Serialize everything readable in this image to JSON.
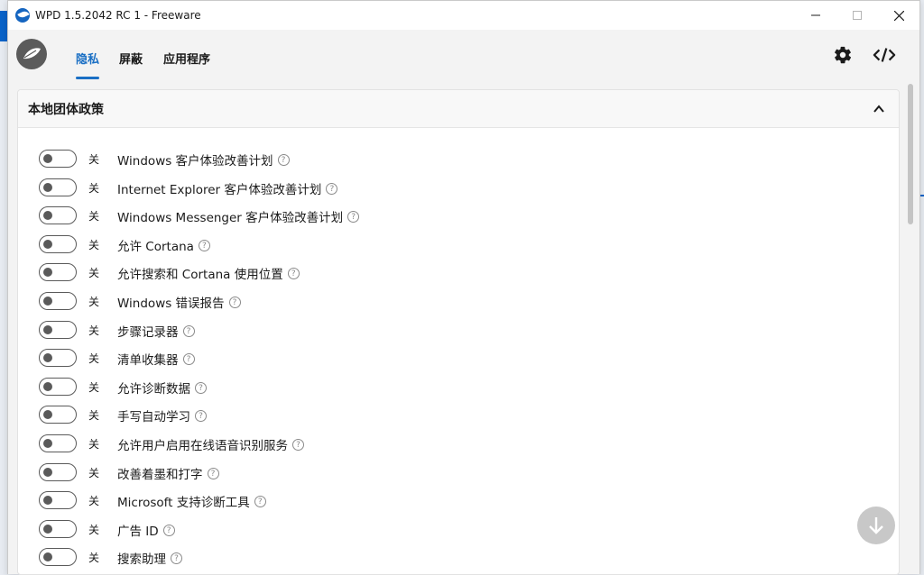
{
  "window": {
    "title": "WPD 1.5.2042 RC 1 - Freeware"
  },
  "tabs": [
    {
      "label": "隐私",
      "active": true
    },
    {
      "label": "屏蔽",
      "active": false
    },
    {
      "label": "应用程序",
      "active": false
    }
  ],
  "toolbar_icons": [
    "gear-icon",
    "code-icon"
  ],
  "panel": {
    "title": "本地团体政策"
  },
  "items": [
    {
      "state": "关",
      "label": "Windows 客户体验改善计划"
    },
    {
      "state": "关",
      "label": "Internet Explorer 客户体验改善计划"
    },
    {
      "state": "关",
      "label": "Windows Messenger 客户体验改善计划"
    },
    {
      "state": "关",
      "label": "允许 Cortana"
    },
    {
      "state": "关",
      "label": "允许搜索和 Cortana 使用位置"
    },
    {
      "state": "关",
      "label": "Windows 错误报告"
    },
    {
      "state": "关",
      "label": "步骤记录器"
    },
    {
      "state": "关",
      "label": "清单收集器"
    },
    {
      "state": "关",
      "label": "允许诊断数据"
    },
    {
      "state": "关",
      "label": "手写自动学习"
    },
    {
      "state": "关",
      "label": "允许用户启用在线语音识别服务"
    },
    {
      "state": "关",
      "label": "改善着墨和打字"
    },
    {
      "state": "关",
      "label": "Microsoft 支持诊断工具"
    },
    {
      "state": "关",
      "label": "广告 ID"
    },
    {
      "state": "关",
      "label": "搜索助理"
    }
  ],
  "colors": {
    "accent": "#1a6fc4",
    "toggle_off": "#5a5a5a"
  }
}
